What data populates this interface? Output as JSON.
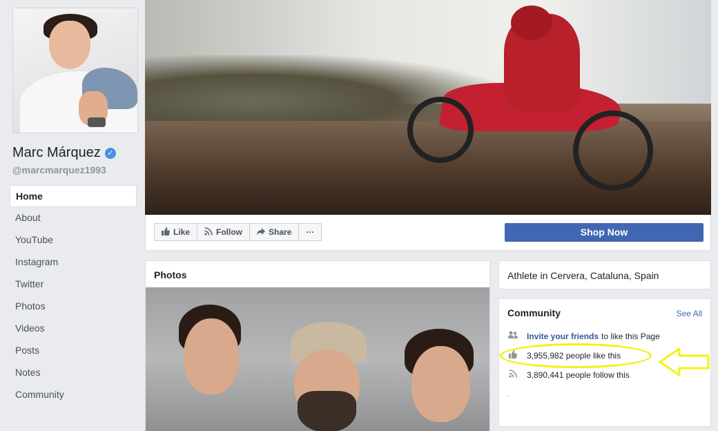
{
  "profile": {
    "name": "Marc Márquez",
    "verified_mark": "✓",
    "handle": "@marcmarquez1993"
  },
  "nav": {
    "items": [
      {
        "label": "Home",
        "active": true
      },
      {
        "label": "About"
      },
      {
        "label": "YouTube"
      },
      {
        "label": "Instagram"
      },
      {
        "label": "Twitter"
      },
      {
        "label": "Photos"
      },
      {
        "label": "Videos"
      },
      {
        "label": "Posts"
      },
      {
        "label": "Notes"
      },
      {
        "label": "Community"
      }
    ]
  },
  "actions": {
    "like": {
      "label": "Like",
      "icon": "thumbs-up-icon"
    },
    "follow": {
      "label": "Follow",
      "icon": "rss-icon"
    },
    "share": {
      "label": "Share",
      "icon": "share-arrow-icon"
    },
    "more": {
      "label": "···",
      "icon": "more-dots-icon"
    },
    "shop_now": "Shop Now"
  },
  "photos": {
    "title": "Photos"
  },
  "info": {
    "text": "Athlete in Cervera, Cataluna, Spain"
  },
  "community": {
    "title": "Community",
    "see_all": "See All",
    "invite_link": "Invite your friends",
    "invite_rest": "to like this Page",
    "likes": "3,955,982 people like this",
    "follows": "3,890,441 people follow this",
    "dot": ","
  },
  "colors": {
    "brand_blue": "#4267b2",
    "link_blue": "#365899",
    "highlight_yellow": "#f5f012",
    "background": "#e9ebee"
  }
}
